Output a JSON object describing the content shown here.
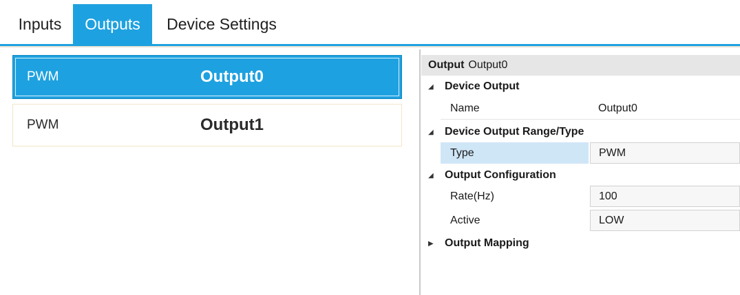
{
  "tabs": [
    {
      "label": "Inputs",
      "active": false
    },
    {
      "label": "Outputs",
      "active": true
    },
    {
      "label": "Device Settings",
      "active": false
    }
  ],
  "outputs": [
    {
      "type": "PWM",
      "name": "Output0",
      "selected": true
    },
    {
      "type": "PWM",
      "name": "Output1",
      "selected": false
    }
  ],
  "properties": {
    "header_key": "Output",
    "header_value": "Output0",
    "categories": [
      {
        "label": "Device Output",
        "expanded": true,
        "rows": [
          {
            "name": "Name",
            "value": "Output0"
          }
        ]
      },
      {
        "label": "Device Output Range/Type",
        "expanded": true,
        "rows": [
          {
            "name": "Type",
            "value": "PWM",
            "selected": true
          }
        ]
      },
      {
        "label": "Output Configuration",
        "expanded": true,
        "rows": [
          {
            "name": "Rate(Hz)",
            "value": "100"
          },
          {
            "name": "Active",
            "value": "LOW"
          }
        ]
      },
      {
        "label": "Output Mapping",
        "expanded": false,
        "rows": []
      }
    ]
  },
  "colors": {
    "accent": "#1ea1e0",
    "selected_property": "#cfe6f7",
    "header_gray": "#e6e6e6"
  },
  "icons": {
    "expanded": "triangle-down-icon",
    "collapsed": "triangle-right-icon"
  }
}
